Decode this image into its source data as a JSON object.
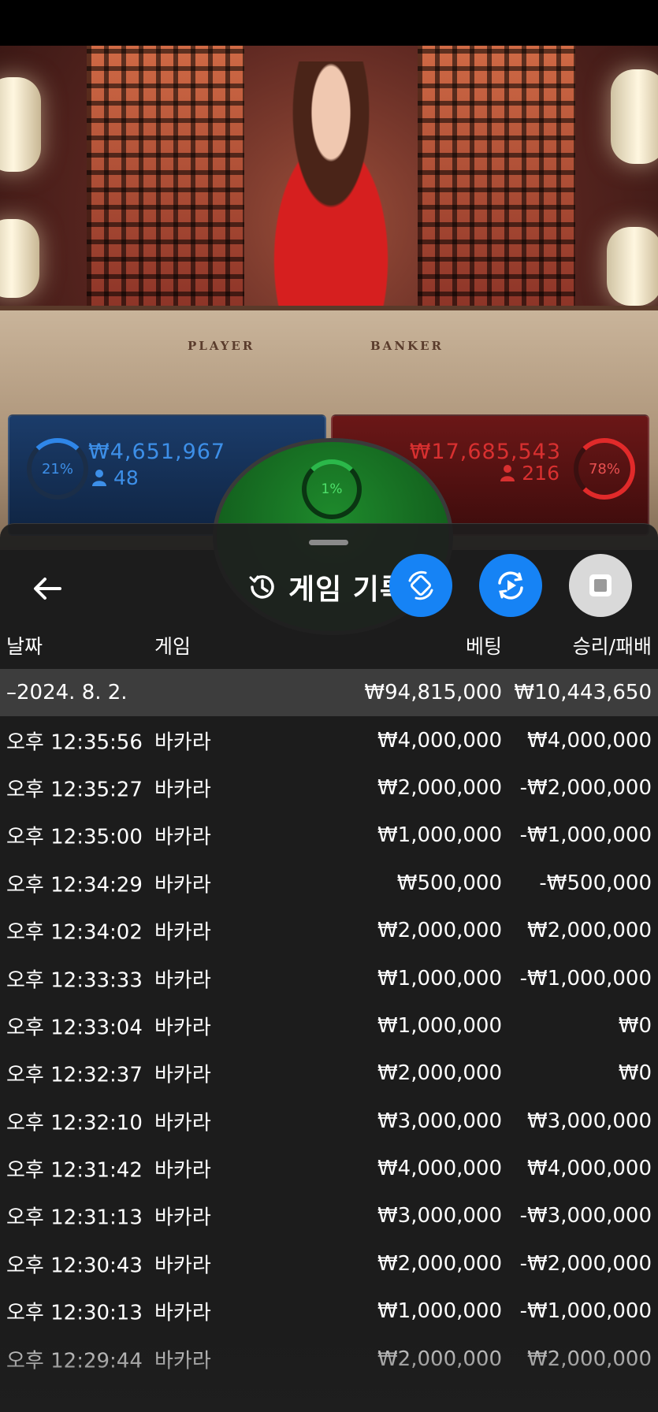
{
  "video": {
    "player_label": "PLAYER",
    "banker_label": "BANKER"
  },
  "bets": {
    "player": {
      "percent": "21%",
      "amount": "₩4,651,967",
      "count": "48"
    },
    "tie": {
      "percent": "1%"
    },
    "banker": {
      "percent": "78%",
      "amount": "₩17,685,543",
      "count": "216"
    }
  },
  "sheet": {
    "title": "게임 기록",
    "icons": {
      "back": "back-arrow-icon",
      "history": "history-clock-icon",
      "rotate": "rotate-device-icon",
      "replay": "replay-icon",
      "stop": "stop-icon"
    },
    "columns": {
      "date": "날짜",
      "game": "게임",
      "bet": "베팅",
      "winloss": "승리/패배"
    },
    "summary": {
      "date": "–2024. 8. 2.",
      "bet": "₩94,815,000",
      "winloss": "₩10,443,650"
    },
    "rows": [
      {
        "time": "오후 12:35:56",
        "game": "바카라",
        "bet": "₩4,000,000",
        "winloss": "₩4,000,000"
      },
      {
        "time": "오후 12:35:27",
        "game": "바카라",
        "bet": "₩2,000,000",
        "winloss": "-₩2,000,000"
      },
      {
        "time": "오후 12:35:00",
        "game": "바카라",
        "bet": "₩1,000,000",
        "winloss": "-₩1,000,000"
      },
      {
        "time": "오후 12:34:29",
        "game": "바카라",
        "bet": "₩500,000",
        "winloss": "-₩500,000"
      },
      {
        "time": "오후 12:34:02",
        "game": "바카라",
        "bet": "₩2,000,000",
        "winloss": "₩2,000,000"
      },
      {
        "time": "오후 12:33:33",
        "game": "바카라",
        "bet": "₩1,000,000",
        "winloss": "-₩1,000,000"
      },
      {
        "time": "오후 12:33:04",
        "game": "바카라",
        "bet": "₩1,000,000",
        "winloss": "₩0"
      },
      {
        "time": "오후 12:32:37",
        "game": "바카라",
        "bet": "₩2,000,000",
        "winloss": "₩0"
      },
      {
        "time": "오후 12:32:10",
        "game": "바카라",
        "bet": "₩3,000,000",
        "winloss": "₩3,000,000"
      },
      {
        "time": "오후 12:31:42",
        "game": "바카라",
        "bet": "₩4,000,000",
        "winloss": "₩4,000,000"
      },
      {
        "time": "오후 12:31:13",
        "game": "바카라",
        "bet": "₩3,000,000",
        "winloss": "-₩3,000,000"
      },
      {
        "time": "오후 12:30:43",
        "game": "바카라",
        "bet": "₩2,000,000",
        "winloss": "-₩2,000,000"
      },
      {
        "time": "오후 12:30:13",
        "game": "바카라",
        "bet": "₩1,000,000",
        "winloss": "-₩1,000,000"
      },
      {
        "time": "오후 12:29:44",
        "game": "바카라",
        "bet": "₩2,000,000",
        "winloss": "₩2,000,000"
      }
    ]
  }
}
